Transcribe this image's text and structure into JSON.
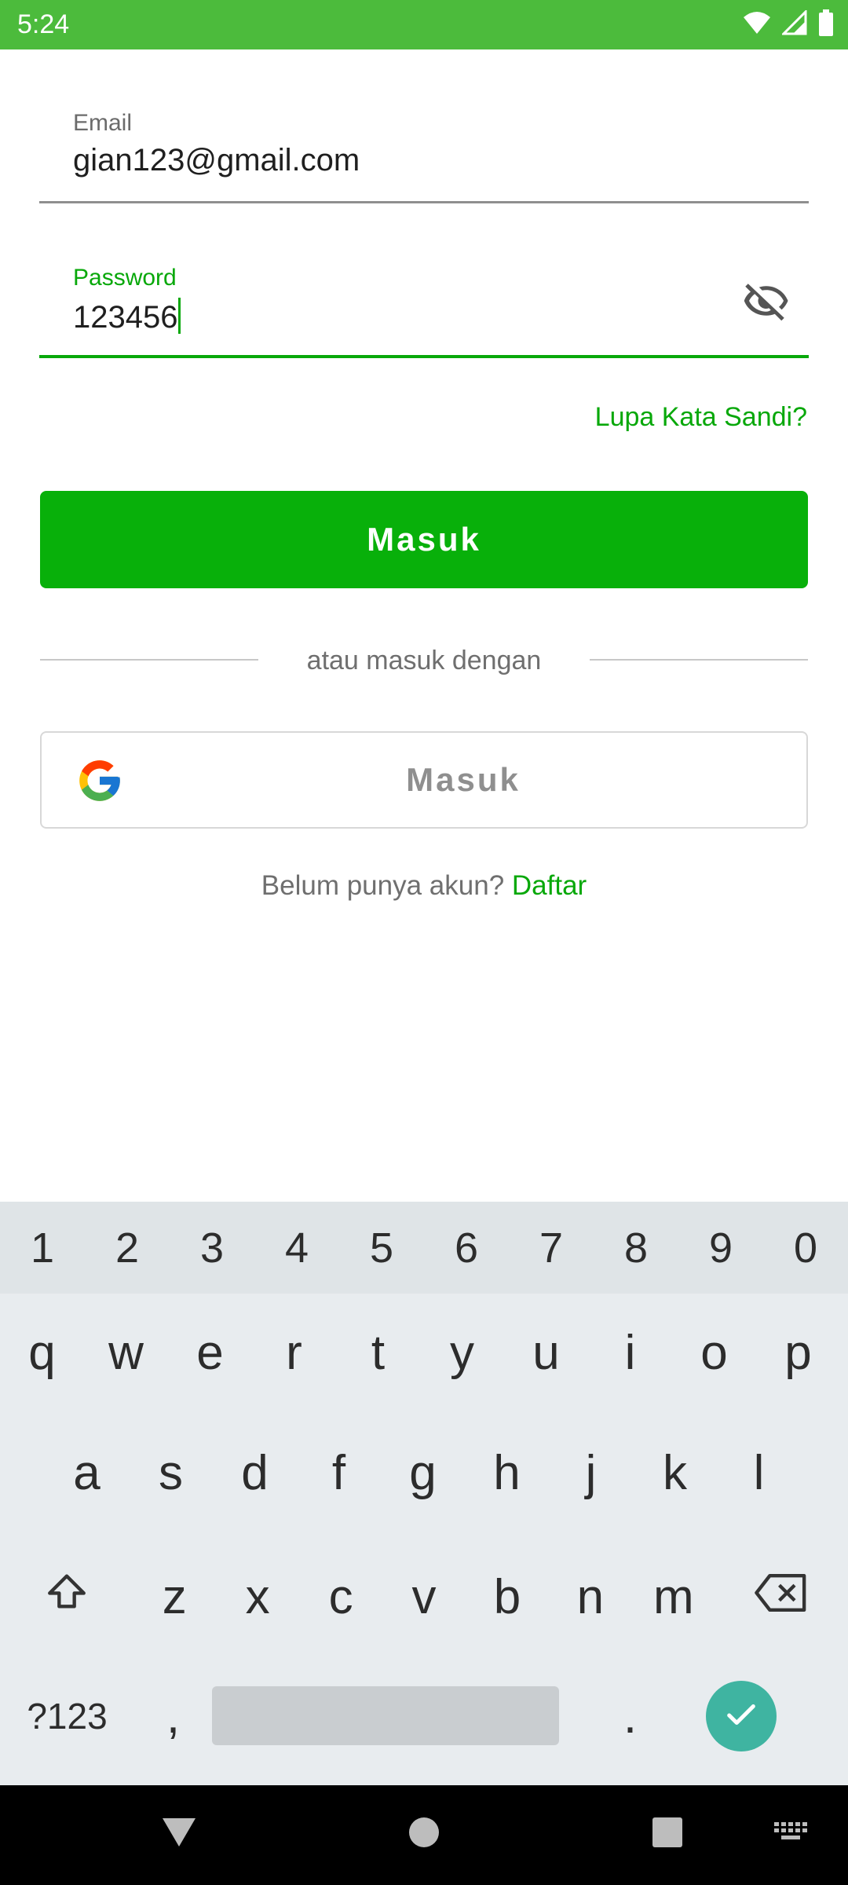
{
  "status_bar": {
    "time": "5:24"
  },
  "email": {
    "label": "Email",
    "value": "gian123@gmail.com"
  },
  "password": {
    "label": "Password",
    "value": "123456"
  },
  "forgot_password": "Lupa Kata Sandi?",
  "login_button": "Masuk",
  "divider_text": "atau masuk dengan",
  "google_button": "Masuk",
  "signup": {
    "prompt": "Belum punya akun?",
    "link": "Daftar"
  },
  "keyboard": {
    "numbers": [
      "1",
      "2",
      "3",
      "4",
      "5",
      "6",
      "7",
      "8",
      "9",
      "0"
    ],
    "row1": [
      "q",
      "w",
      "e",
      "r",
      "t",
      "y",
      "u",
      "i",
      "o",
      "p"
    ],
    "row2": [
      "a",
      "s",
      "d",
      "f",
      "g",
      "h",
      "j",
      "k",
      "l"
    ],
    "row3": [
      "z",
      "x",
      "c",
      "v",
      "b",
      "n",
      "m"
    ],
    "symbols_key": "?123",
    "comma_key": ",",
    "period_key": "."
  },
  "colors": {
    "accent": "#08b00a",
    "status_bar": "#4cbb3c",
    "done_key": "#3fb4a1"
  }
}
